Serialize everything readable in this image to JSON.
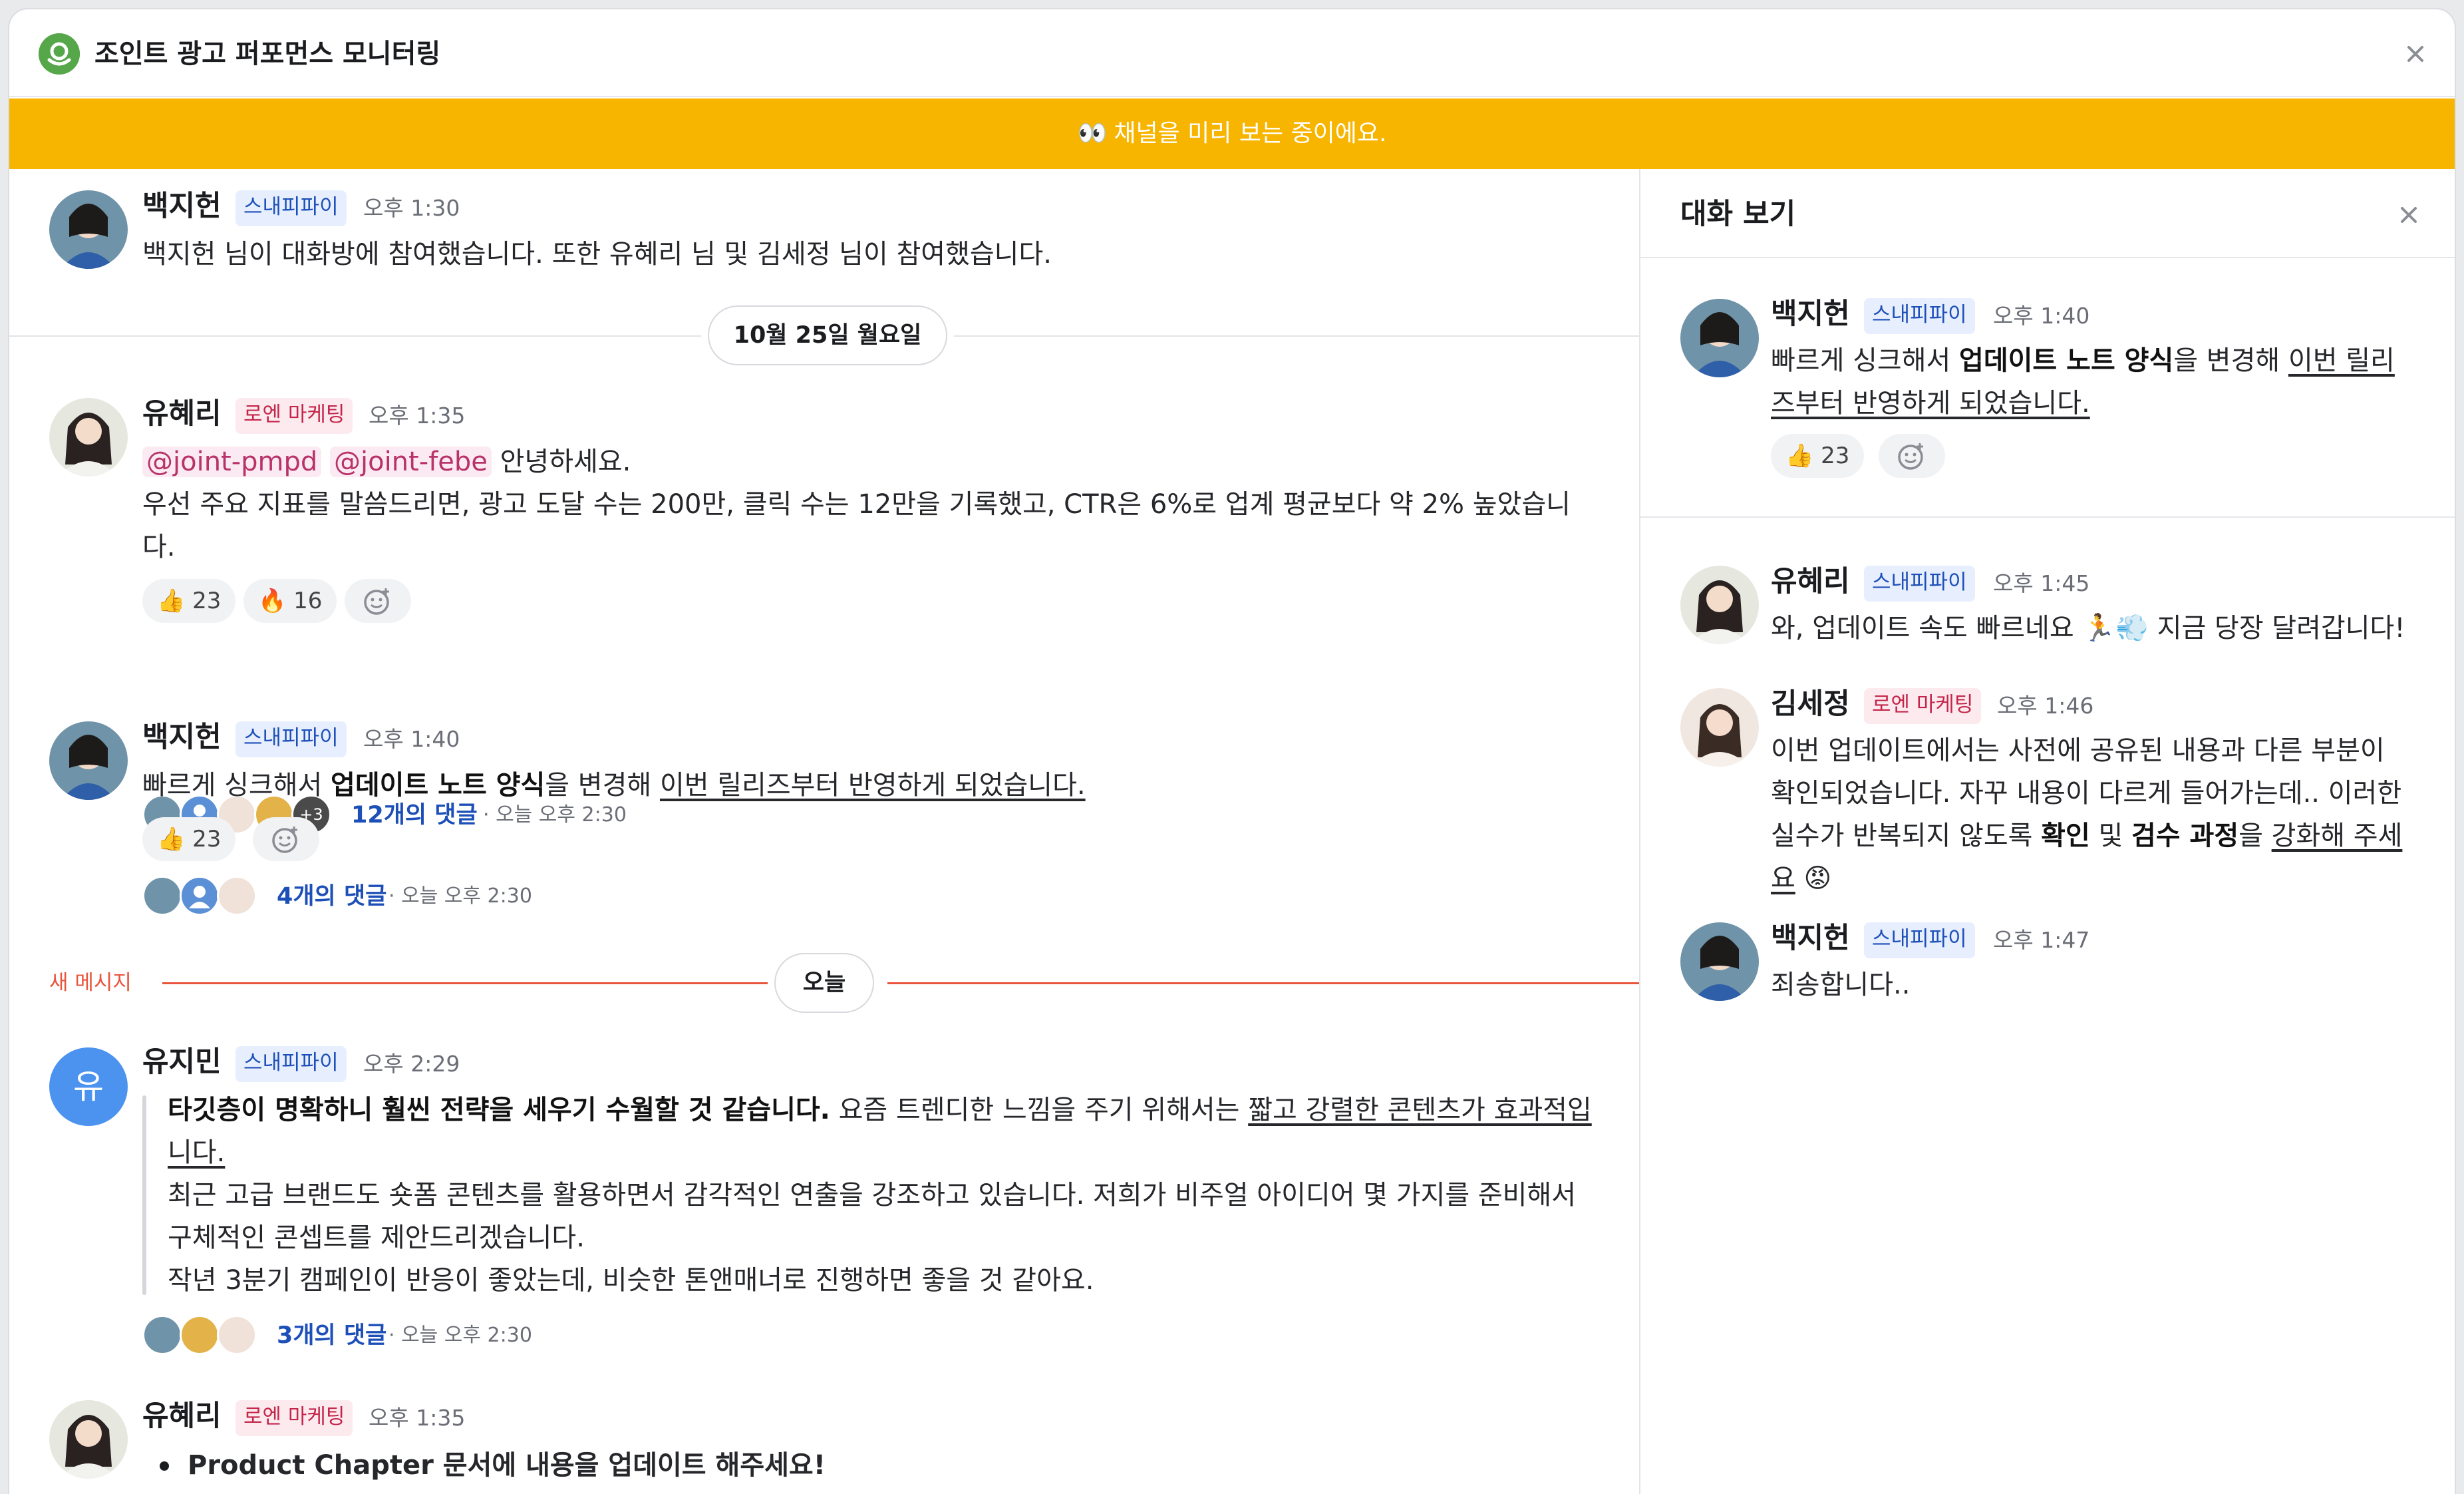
{
  "window": {
    "title": "조인트 광고 퍼포먼스 모니터링"
  },
  "banner": {
    "icon": "👀",
    "text": "채널을 미리 보는 중이에요."
  },
  "labels": {
    "new_messages": "새 메시지"
  },
  "messages": [
    {
      "name": "백지헌",
      "tag": "스내피파이",
      "time": "오후 1:30",
      "text": "백지헌 님이 대화방에 참여했습니다. 또한 유혜리 님 및 김세정 님이 참여했습니다."
    },
    {
      "name": "유혜리",
      "tag": "로엔 마케팅",
      "time": "오후 1:35",
      "mention1": "@joint-pmpd",
      "mention2": "@joint-febe",
      "greeting": "안녕하세요.",
      "line1": "우선 주요 지표를 말씀드리면, 광고 도달 수는 200만, 클릭 수는 12만을 기록했고, CTR은 6%로 업계 평균보다 약 2% 높았습니",
      "line2": "다.",
      "reactions": [
        {
          "emoji": "👍",
          "count": "23"
        },
        {
          "emoji": "🔥",
          "count": "16"
        }
      ],
      "thread": {
        "count_label": "12개의 댓글",
        "meta": "· 오늘 오후 2:30",
        "extra": "+3"
      }
    },
    {
      "name": "백지헌",
      "tag": "스내피파이",
      "time": "오후 1:40",
      "pre": "빠르게 싱크해서 ",
      "bold": "업데이트 노트 양식",
      "mid": "을 변경해 ",
      "link": "이번 릴리즈부터 반영하게 되었습니다.",
      "reactions": [
        {
          "emoji": "👍",
          "count": "23"
        }
      ],
      "thread": {
        "count_label": "4개의 댓글",
        "meta": "· 오늘 오후 2:30"
      }
    },
    {
      "name": "유지민",
      "tag": "스내피파이",
      "time": "오후 2:29",
      "initial": "유",
      "q_bold": "타깃층이 명확하니 훨씬 전략을 세우기 수월할 것 같습니다.",
      "q_mid": " 요즘 트렌디한 느낌을 주기 위해서는 ",
      "q_link1": "짧고 강렬한 콘텐츠가 효과적입",
      "q_link2": "니다.",
      "q_line3": "최근 고급 브랜드도 숏폼 콘텐츠를 활용하면서 감각적인 연출을 강조하고 있습니다. 저희가 비주얼 아이디어 몇 가지를 준비해서",
      "q_line4": "구체적인 콘셉트를 제안드리겠습니다.",
      "q_line5": "작년 3분기 캠페인이 반응이 좋았는데, 비슷한 톤앤매너로 진행하면 좋을 것 같아요.",
      "thread": {
        "count_label": "3개의 댓글",
        "meta": "· 오늘 오후 2:30"
      }
    },
    {
      "name": "유혜리",
      "tag": "로엔 마케팅",
      "time": "오후 1:35",
      "bullet": "Product Chapter 문서에 내용을 업데이트 해주세요!"
    }
  ],
  "dividers": {
    "date": "10월 25일 월요일",
    "today": "오늘"
  },
  "side": {
    "title": "대화 보기",
    "root": {
      "name": "백지헌",
      "tag": "스내피파이",
      "time": "오후 1:40",
      "pre": "빠르게 싱크해서 ",
      "bold": "업데이트 노트 양식",
      "mid": "을 변경해 ",
      "link1": "이번 릴리",
      "link2": "즈부터 반영하게 되었습니다.",
      "reaction": {
        "emoji": "👍",
        "count": "23"
      }
    },
    "replies": [
      {
        "name": "유혜리",
        "tag": "스내피파이",
        "time": "오후 1:45",
        "pre": "와, 업데이트 속도 빠르네요 ",
        "emoji": "🏃💨",
        "post": " 지금 당장 달려갑니다!"
      },
      {
        "name": "김세정",
        "tag": "로엔 마케팅",
        "time": "오후 1:46",
        "line1": "이번 업데이트에서는 사전에 공유된 내용과 다른 부분이",
        "line2": "확인되었습니다. 자꾸 내용이 다르게 들어가는데.. 이러한",
        "line3_pre": "실수가 반복되지 않도록 ",
        "line3_bold1": "확인",
        "line3_mid": " 및 ",
        "line3_bold2": "검수 과정",
        "line3_post": "을 ",
        "line3_link": "강화해 주세",
        "line4_link": "요",
        "line4_emoji": "😡"
      },
      {
        "name": "백지헌",
        "tag": "스내피파이",
        "time": "오후 1:47",
        "text": "죄송합니다.."
      }
    ]
  },
  "colors": {
    "banner": "#f7b500",
    "accent_red": "#e8553c",
    "link_blue": "#1d4fb8",
    "brand_green": "#56a64a"
  }
}
